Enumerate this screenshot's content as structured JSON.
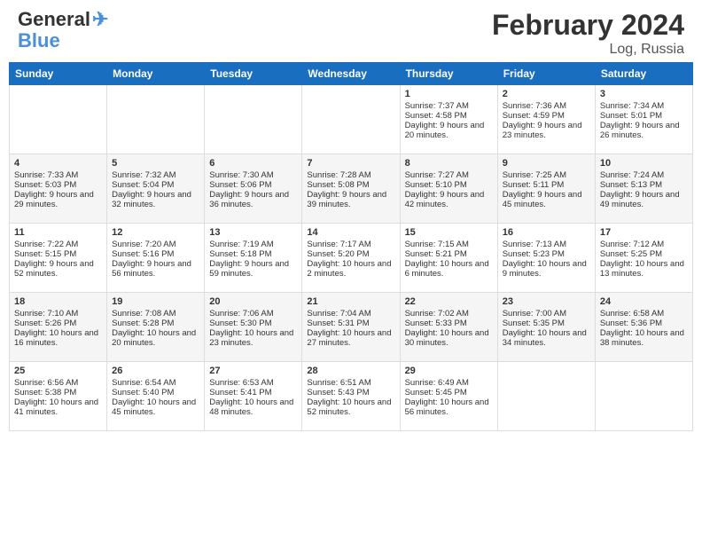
{
  "header": {
    "logo_line1": "General",
    "logo_line2": "Blue",
    "title": "February 2024",
    "subtitle": "Log, Russia"
  },
  "days_of_week": [
    "Sunday",
    "Monday",
    "Tuesday",
    "Wednesday",
    "Thursday",
    "Friday",
    "Saturday"
  ],
  "weeks": [
    [
      {
        "day": "",
        "data": ""
      },
      {
        "day": "",
        "data": ""
      },
      {
        "day": "",
        "data": ""
      },
      {
        "day": "",
        "data": ""
      },
      {
        "day": "1",
        "sunrise": "Sunrise: 7:37 AM",
        "sunset": "Sunset: 4:58 PM",
        "daylight": "Daylight: 9 hours and 20 minutes."
      },
      {
        "day": "2",
        "sunrise": "Sunrise: 7:36 AM",
        "sunset": "Sunset: 4:59 PM",
        "daylight": "Daylight: 9 hours and 23 minutes."
      },
      {
        "day": "3",
        "sunrise": "Sunrise: 7:34 AM",
        "sunset": "Sunset: 5:01 PM",
        "daylight": "Daylight: 9 hours and 26 minutes."
      }
    ],
    [
      {
        "day": "4",
        "sunrise": "Sunrise: 7:33 AM",
        "sunset": "Sunset: 5:03 PM",
        "daylight": "Daylight: 9 hours and 29 minutes."
      },
      {
        "day": "5",
        "sunrise": "Sunrise: 7:32 AM",
        "sunset": "Sunset: 5:04 PM",
        "daylight": "Daylight: 9 hours and 32 minutes."
      },
      {
        "day": "6",
        "sunrise": "Sunrise: 7:30 AM",
        "sunset": "Sunset: 5:06 PM",
        "daylight": "Daylight: 9 hours and 36 minutes."
      },
      {
        "day": "7",
        "sunrise": "Sunrise: 7:28 AM",
        "sunset": "Sunset: 5:08 PM",
        "daylight": "Daylight: 9 hours and 39 minutes."
      },
      {
        "day": "8",
        "sunrise": "Sunrise: 7:27 AM",
        "sunset": "Sunset: 5:10 PM",
        "daylight": "Daylight: 9 hours and 42 minutes."
      },
      {
        "day": "9",
        "sunrise": "Sunrise: 7:25 AM",
        "sunset": "Sunset: 5:11 PM",
        "daylight": "Daylight: 9 hours and 45 minutes."
      },
      {
        "day": "10",
        "sunrise": "Sunrise: 7:24 AM",
        "sunset": "Sunset: 5:13 PM",
        "daylight": "Daylight: 9 hours and 49 minutes."
      }
    ],
    [
      {
        "day": "11",
        "sunrise": "Sunrise: 7:22 AM",
        "sunset": "Sunset: 5:15 PM",
        "daylight": "Daylight: 9 hours and 52 minutes."
      },
      {
        "day": "12",
        "sunrise": "Sunrise: 7:20 AM",
        "sunset": "Sunset: 5:16 PM",
        "daylight": "Daylight: 9 hours and 56 minutes."
      },
      {
        "day": "13",
        "sunrise": "Sunrise: 7:19 AM",
        "sunset": "Sunset: 5:18 PM",
        "daylight": "Daylight: 9 hours and 59 minutes."
      },
      {
        "day": "14",
        "sunrise": "Sunrise: 7:17 AM",
        "sunset": "Sunset: 5:20 PM",
        "daylight": "Daylight: 10 hours and 2 minutes."
      },
      {
        "day": "15",
        "sunrise": "Sunrise: 7:15 AM",
        "sunset": "Sunset: 5:21 PM",
        "daylight": "Daylight: 10 hours and 6 minutes."
      },
      {
        "day": "16",
        "sunrise": "Sunrise: 7:13 AM",
        "sunset": "Sunset: 5:23 PM",
        "daylight": "Daylight: 10 hours and 9 minutes."
      },
      {
        "day": "17",
        "sunrise": "Sunrise: 7:12 AM",
        "sunset": "Sunset: 5:25 PM",
        "daylight": "Daylight: 10 hours and 13 minutes."
      }
    ],
    [
      {
        "day": "18",
        "sunrise": "Sunrise: 7:10 AM",
        "sunset": "Sunset: 5:26 PM",
        "daylight": "Daylight: 10 hours and 16 minutes."
      },
      {
        "day": "19",
        "sunrise": "Sunrise: 7:08 AM",
        "sunset": "Sunset: 5:28 PM",
        "daylight": "Daylight: 10 hours and 20 minutes."
      },
      {
        "day": "20",
        "sunrise": "Sunrise: 7:06 AM",
        "sunset": "Sunset: 5:30 PM",
        "daylight": "Daylight: 10 hours and 23 minutes."
      },
      {
        "day": "21",
        "sunrise": "Sunrise: 7:04 AM",
        "sunset": "Sunset: 5:31 PM",
        "daylight": "Daylight: 10 hours and 27 minutes."
      },
      {
        "day": "22",
        "sunrise": "Sunrise: 7:02 AM",
        "sunset": "Sunset: 5:33 PM",
        "daylight": "Daylight: 10 hours and 30 minutes."
      },
      {
        "day": "23",
        "sunrise": "Sunrise: 7:00 AM",
        "sunset": "Sunset: 5:35 PM",
        "daylight": "Daylight: 10 hours and 34 minutes."
      },
      {
        "day": "24",
        "sunrise": "Sunrise: 6:58 AM",
        "sunset": "Sunset: 5:36 PM",
        "daylight": "Daylight: 10 hours and 38 minutes."
      }
    ],
    [
      {
        "day": "25",
        "sunrise": "Sunrise: 6:56 AM",
        "sunset": "Sunset: 5:38 PM",
        "daylight": "Daylight: 10 hours and 41 minutes."
      },
      {
        "day": "26",
        "sunrise": "Sunrise: 6:54 AM",
        "sunset": "Sunset: 5:40 PM",
        "daylight": "Daylight: 10 hours and 45 minutes."
      },
      {
        "day": "27",
        "sunrise": "Sunrise: 6:53 AM",
        "sunset": "Sunset: 5:41 PM",
        "daylight": "Daylight: 10 hours and 48 minutes."
      },
      {
        "day": "28",
        "sunrise": "Sunrise: 6:51 AM",
        "sunset": "Sunset: 5:43 PM",
        "daylight": "Daylight: 10 hours and 52 minutes."
      },
      {
        "day": "29",
        "sunrise": "Sunrise: 6:49 AM",
        "sunset": "Sunset: 5:45 PM",
        "daylight": "Daylight: 10 hours and 56 minutes."
      },
      {
        "day": "",
        "data": ""
      },
      {
        "day": "",
        "data": ""
      }
    ]
  ]
}
